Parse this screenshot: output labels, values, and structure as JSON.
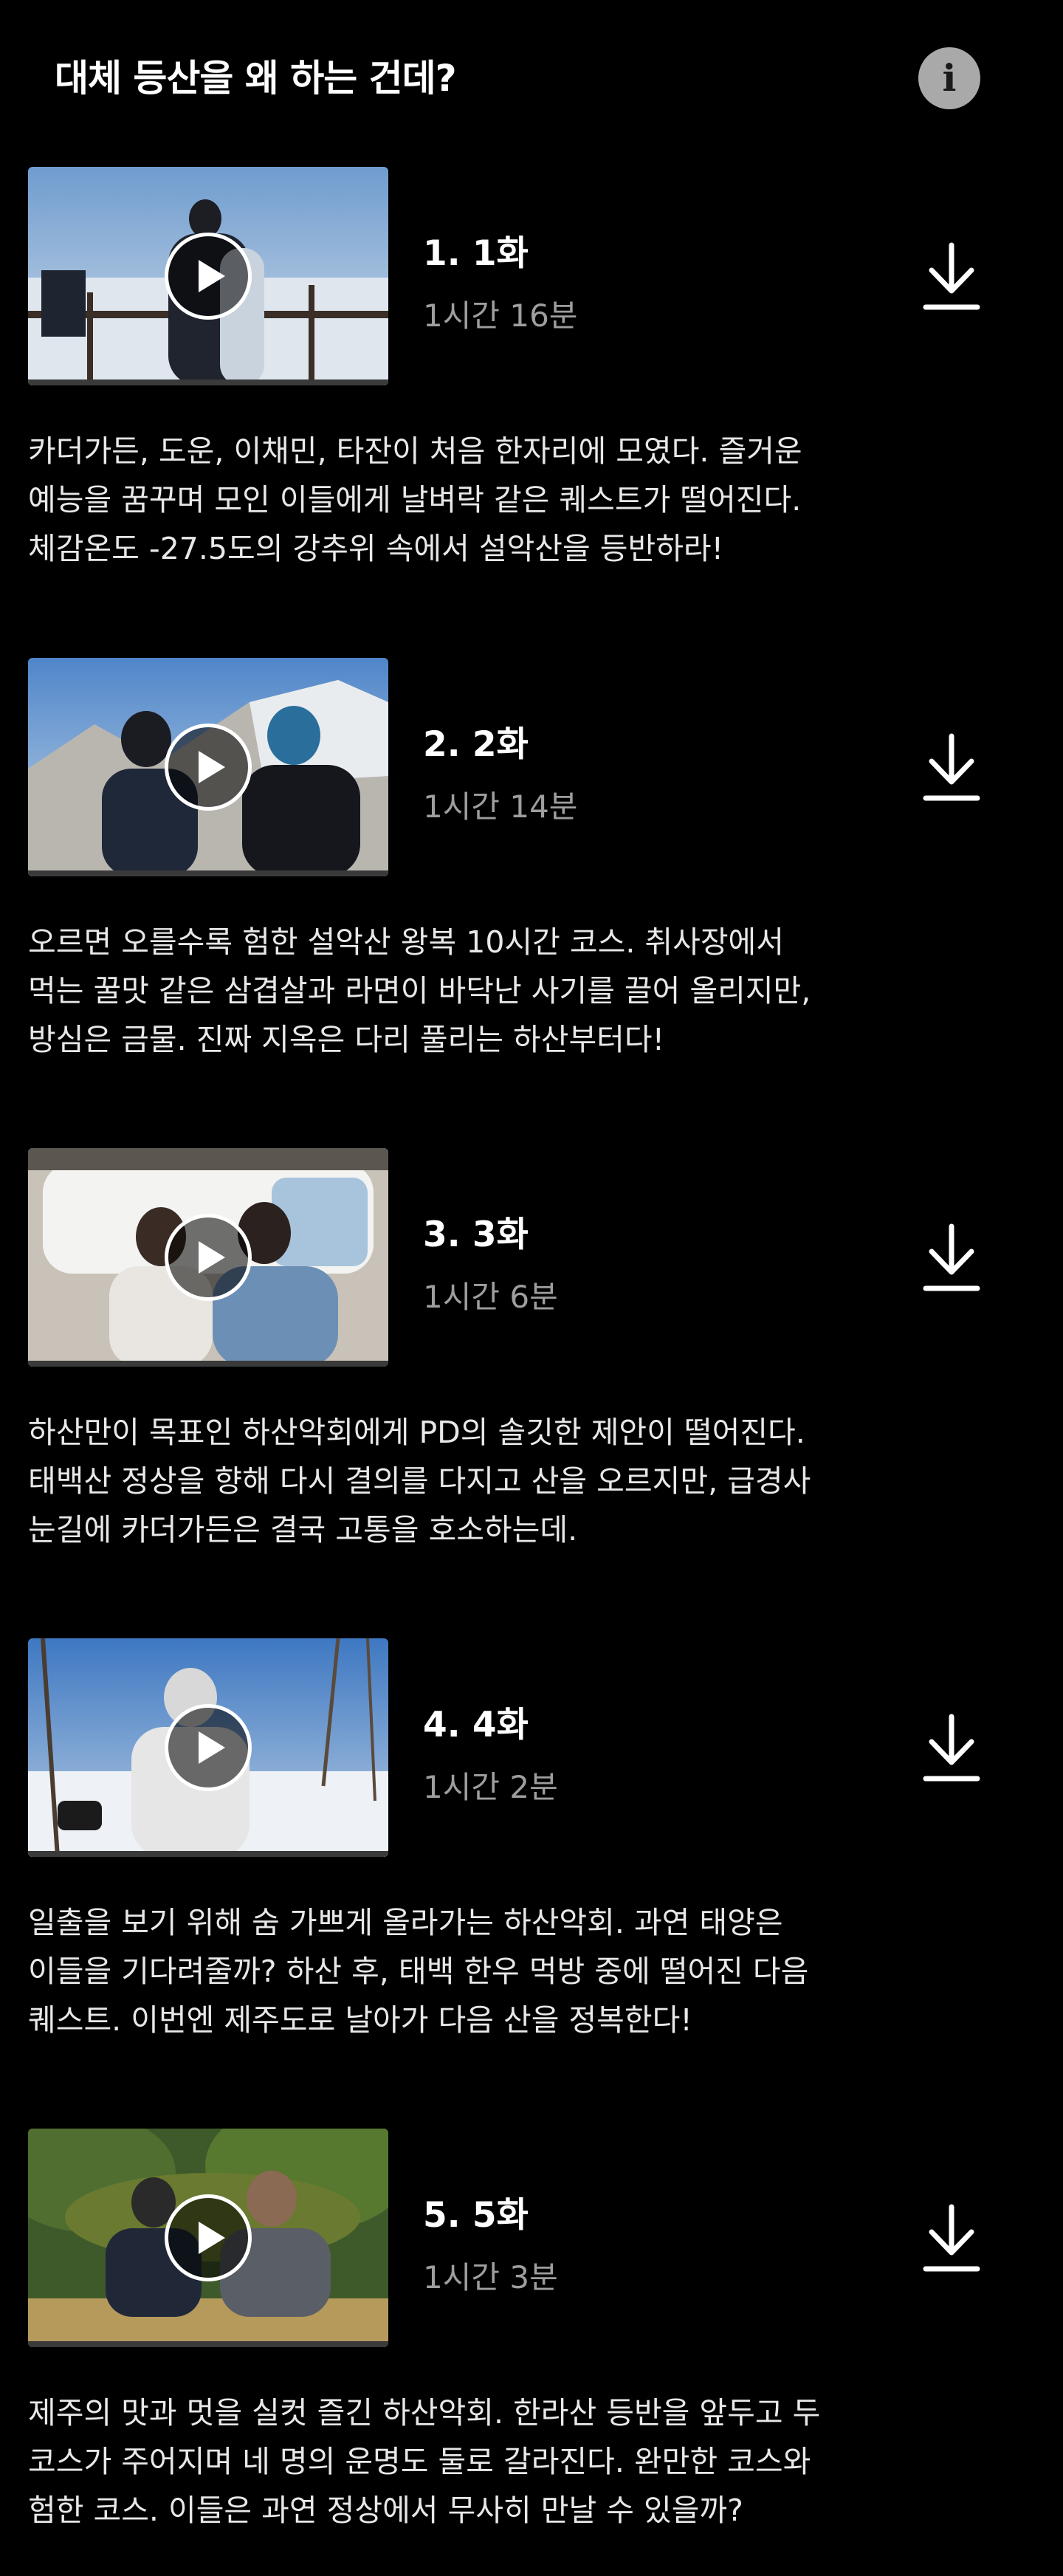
{
  "header": {
    "title": "대체 등산을 왜 하는 건데?",
    "info_icon": "info-icon"
  },
  "episodes": [
    {
      "title": "1. 1화",
      "duration": "1시간 16분",
      "description": "카더가든, 도운, 이채민, 타잔이 처음 한자리에 모였다. 즐거운\n예능을 꿈꾸며 모인 이들에게 날벼락 같은 퀘스트가 떨어진다.\n체감온도 -27.5도의 강추위 속에서 설악산을 등반하라!"
    },
    {
      "title": "2. 2화",
      "duration": "1시간 14분",
      "description": "오르면 오를수록 험한 설악산 왕복 10시간 코스. 취사장에서\n먹는 꿀맛 같은 삼겹살과 라면이 바닥난 사기를 끌어 올리지만,\n방심은 금물. 진짜 지옥은 다리 풀리는 하산부터다!"
    },
    {
      "title": "3. 3화",
      "duration": "1시간 6분",
      "description": "하산만이 목표인 하산악회에게 PD의 솔깃한 제안이 떨어진다.\n태백산 정상을 향해 다시 결의를 다지고 산을 오르지만, 급경사\n눈길에 카더가든은 결국 고통을 호소하는데."
    },
    {
      "title": "4. 4화",
      "duration": "1시간 2분",
      "description": "일출을 보기 위해 숨 가쁘게 올라가는 하산악회. 과연 태양은\n이들을 기다려줄까? 하산 후, 태백 한우 먹방 중에 떨어진 다음\n퀘스트. 이번엔 제주도로 날아가 다음 산을 정복한다!"
    },
    {
      "title": "5. 5화",
      "duration": "1시간 3분",
      "description": "제주의 맛과 멋을 실컷 즐긴 하산악회. 한라산 등반을 앞두고 두\n코스가 주어지며 네 명의 운명도 둘로 갈라진다. 완만한 코스와\n험한 코스. 이들은 과연 정상에서 무사히 만날 수 있을까?"
    }
  ],
  "icons": {
    "play": "play-icon",
    "download": "download-icon"
  }
}
